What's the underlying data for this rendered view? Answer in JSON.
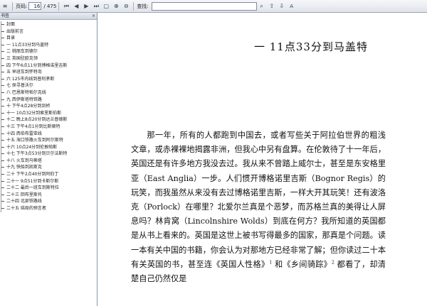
{
  "toolbar": {
    "page_label": "页码:",
    "current_page": "16",
    "total_pages": "/ 475",
    "search_label": "查找:"
  },
  "sidebar": {
    "header": "书签",
    "close_glyph": "×",
    "items": [
      {
        "label": "封面"
      },
      {
        "label": "出版前言"
      },
      {
        "label": "目录"
      },
      {
        "label": "一 11点33分到马盖特"
      },
      {
        "label": "二 桃丽车到德尔"
      },
      {
        "label": "三 英国驻欧克领"
      },
      {
        "label": "四 下午6点11分到博格诺里吉斯"
      },
      {
        "label": "五 早班车到怀特岛"
      },
      {
        "label": "六 125市内线到普利茅斯"
      },
      {
        "label": "七 探寻普沃尔"
      },
      {
        "label": "八 巴恩斯特帕尔克线"
      },
      {
        "label": "九 西伊斯塔特铁路"
      },
      {
        "label": "十 下午4点28分到剑桥"
      },
      {
        "label": "十一 10点32分到索里斯伯斯"
      },
      {
        "label": "十二 晚上8点20分到达兰普德斯"
      },
      {
        "label": "十三 下午4点1分到比斯顿特"
      },
      {
        "label": "十四 西伯布雷亚线"
      },
      {
        "label": "十五 海口铁路火车到阿尔斯特"
      },
      {
        "label": "十六 10点24分到伦敦帕斯"
      },
      {
        "label": "十七 下午3点53分到贝尔法斯特"
      },
      {
        "label": "十八 火车到马蒂塔"
      },
      {
        "label": "十九 快船到凯斯克"
      },
      {
        "label": "二十 下午2点40分到阿伯丁"
      },
      {
        "label": "二十一 9点51分到卡斯尔斯"
      },
      {
        "label": "二十二 最后一班车到斯特拉"
      },
      {
        "label": "二十三 回布里斯托"
      },
      {
        "label": "二十四 北部铁路线"
      },
      {
        "label": "二十五 结局的预言者"
      }
    ]
  },
  "page": {
    "chapter_title": "一 11点33分到马盖特",
    "paragraph_1a": "那一年，所有的人都跑到中国去，或者写些关于阿拉伯世界的粗浅文章，或赤裸裸地揭露非洲，但我心中另有盘算。在伦敦待了十一年后，英国还是有许多地方我没去过。我从来不曾踏上威尔士，甚至是东安格里亚（East Anglia）一步。人们惯开博格诺里吉斯（Bognor Regis）的玩笑，而我虽然从来没有去过博格诺里吉斯，一样大开其玩笑！还有波洛克（Porlock）在哪里？北爱尔兰真是个恶梦，而苏格兰真的美得让人屏息吗？林肯窝（Lincolnshire Wolds）到底在何方？我所知道的英国都是从书上看来的。英国是这世上被书写得最多的国家，那真是个问题。读一本有关中国的书籍，你会认为对那地方已经非常了解；但你读过二十本有关英国的书，甚至连《英国人性格》",
    "sup_1": "1",
    "paragraph_1b": " 和《乡间骑踪》",
    "sup_2": "2",
    "paragraph_1c": " 都看了，却清楚自己仍然仅是"
  }
}
